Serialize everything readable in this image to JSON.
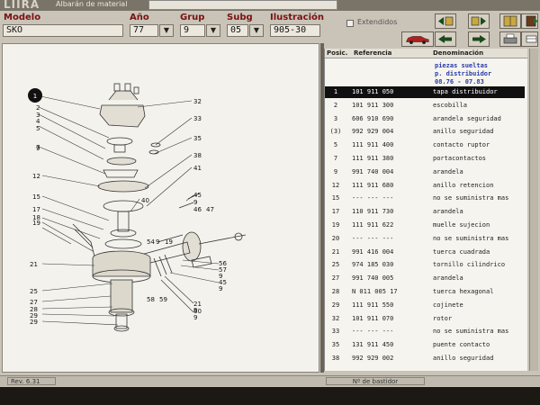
{
  "app": {
    "logo": "LIIRA",
    "subtitle": "Albarán de material",
    "top_box": ""
  },
  "header": {
    "modelo_label": "Modelo",
    "modelo_value": "SKO",
    "ano_label": "Año",
    "ano_value": "77",
    "grup_label": "Grup",
    "grup_value": "9",
    "subg_label": "Subg",
    "subg_value": "05",
    "ilustracion_label": "Ilustración",
    "ilustracion_value": "905-30",
    "extendidos_label": "Extendidos",
    "dropdown_glyph": "▼"
  },
  "list": {
    "col_posic": "Posic.",
    "col_referencia": "Referencia",
    "col_denominacion": "Denominación",
    "info": [
      "piezas sueltas",
      "p. distribuidor",
      "08.76 - 07.83"
    ],
    "rows": [
      {
        "pos": "1",
        "ref": "101 911 050",
        "den": "tapa distribuidor",
        "selected": true
      },
      {
        "pos": "2",
        "ref": "101 911 300",
        "den": "escobilla"
      },
      {
        "pos": "3",
        "ref": "606 910 690",
        "den": "arandela seguridad"
      },
      {
        "pos": "(3)",
        "ref": "992 929 004",
        "den": "anillo seguridad"
      },
      {
        "pos": "5",
        "ref": "111 911 400",
        "den": "contacto ruptor"
      },
      {
        "pos": "7",
        "ref": "111 911 380",
        "den": "portacontactos"
      },
      {
        "pos": "9",
        "ref": "991 740 004",
        "den": "arandela"
      },
      {
        "pos": "12",
        "ref": "111 911 680",
        "den": "anillo retencion"
      },
      {
        "pos": "15",
        "ref": "--- --- ---",
        "den": "no se suministra mas"
      },
      {
        "pos": "17",
        "ref": "110 911 730",
        "den": "arandela"
      },
      {
        "pos": "19",
        "ref": "111 911 622",
        "den": "muelle sujecion"
      },
      {
        "pos": "20",
        "ref": "--- --- ---",
        "den": "no se suministra mas"
      },
      {
        "pos": "21",
        "ref": "991 416 004",
        "den": "tuerca cuadrada"
      },
      {
        "pos": "25",
        "ref": "974 185 030",
        "den": "tornillo cilindrico"
      },
      {
        "pos": "27",
        "ref": "991 740 005",
        "den": "arandela"
      },
      {
        "pos": "28",
        "ref": "N   011 005 17",
        "den": "tuerca hexagonal"
      },
      {
        "pos": "29",
        "ref": "111 911 550",
        "den": "cojinete"
      },
      {
        "pos": "32",
        "ref": "101 911 070",
        "den": "rotor"
      },
      {
        "pos": "33",
        "ref": "--- --- ---",
        "den": "no se suministra mas"
      },
      {
        "pos": "35",
        "ref": "131 911 450",
        "den": "puente contacto"
      },
      {
        "pos": "38",
        "ref": "992 929 002",
        "den": "anillo seguridad"
      }
    ]
  },
  "diagram": {
    "callouts": [
      "1",
      "2",
      "3",
      "4",
      "5",
      "7",
      "9",
      "12",
      "15",
      "17",
      "18",
      "19",
      "21",
      "25",
      "27",
      "28",
      "29",
      "29",
      "32",
      "33",
      "35",
      "38",
      "40",
      "41",
      "45",
      "9",
      "46",
      "47",
      "54",
      "9",
      "19",
      "56",
      "57",
      "9",
      "45",
      "9",
      "58",
      "59",
      "21",
      "9",
      "60",
      "9"
    ]
  },
  "status": {
    "rev": "Rev. 6.31",
    "bastidor": "Nº de bastidor"
  }
}
